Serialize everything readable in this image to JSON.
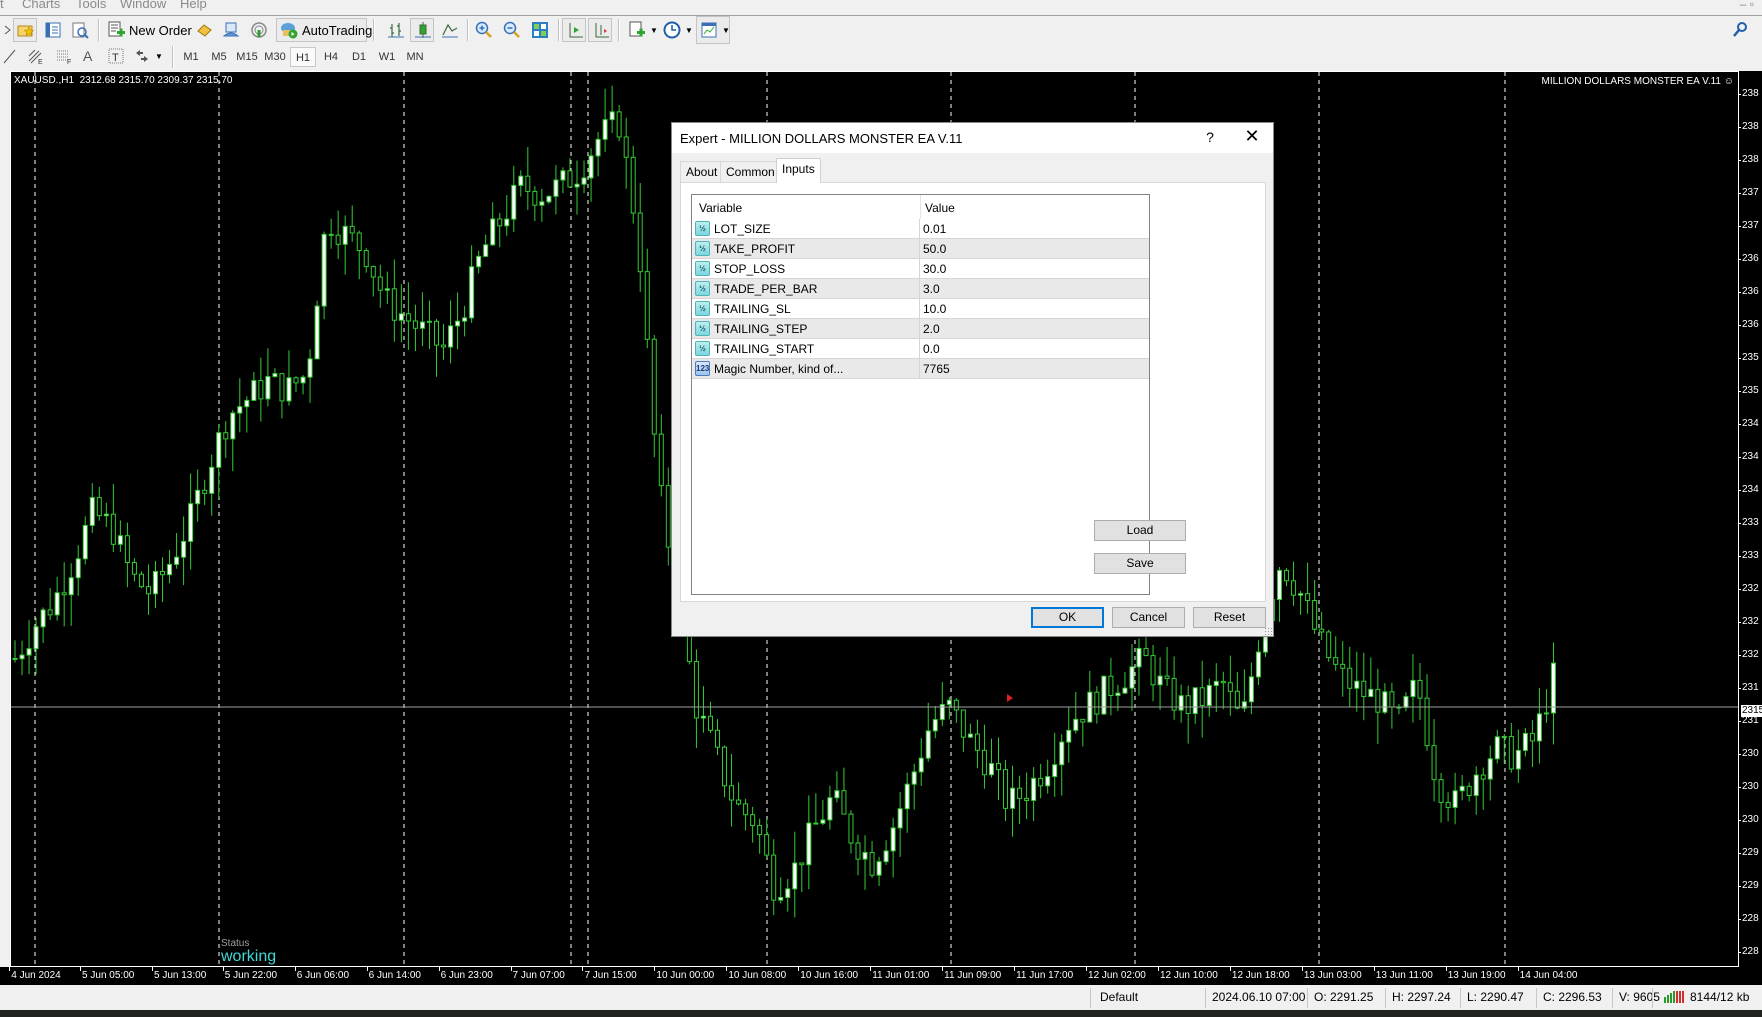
{
  "menu": {
    "items": [
      "Charts",
      "Tools",
      "Window",
      "Help"
    ]
  },
  "toolbar": {
    "new_order": "New Order",
    "autotrading": "AutoTrading",
    "timeframes": [
      "M1",
      "M5",
      "M15",
      "M30",
      "H1",
      "H4",
      "D1",
      "W1",
      "MN"
    ],
    "active_timeframe": "H1"
  },
  "chart": {
    "symbol_line": "XAUUSD.,H1  2312.68 2315.70 2309.37 2315.70",
    "ea_label": "MILLION DOLLARS MONSTER EA V.11",
    "status_label": "Status",
    "status_value": "working",
    "current_price": "2315",
    "price_labels": [
      "238",
      "238",
      "238",
      "237",
      "237",
      "236",
      "236",
      "236",
      "235",
      "235",
      "234",
      "234",
      "234",
      "233",
      "233",
      "232",
      "232",
      "232",
      "231",
      "231",
      "230",
      "230",
      "230",
      "229",
      "229",
      "228",
      "228"
    ],
    "time_labels": [
      "4 Jun 2024",
      "5 Jun 05:00",
      "5 Jun 13:00",
      "5 Jun 22:00",
      "6 Jun 06:00",
      "6 Jun 14:00",
      "6 Jun 23:00",
      "7 Jun 07:00",
      "7 Jun 15:00",
      "10 Jun 00:00",
      "10 Jun 08:00",
      "10 Jun 16:00",
      "11 Jun 01:00",
      "11 Jun 09:00",
      "11 Jun 17:00",
      "12 Jun 02:00",
      "12 Jun 10:00",
      "12 Jun 18:00",
      "13 Jun 03:00",
      "13 Jun 11:00",
      "13 Jun 19:00",
      "14 Jun 04:00"
    ],
    "colors": {
      "background": "#000000",
      "candle": "#33cc33",
      "bull_body": "#ffffff",
      "grid": "#ffffff",
      "bid_line": "#a0a0a0",
      "status_value": "#3fd9d9"
    }
  },
  "chart_data": {
    "type": "candlestick",
    "title": "XAUUSD.,H1",
    "ylim": [
      2280,
      2390
    ],
    "closes": [
      2318,
      2322,
      2325,
      2330,
      2336,
      2334,
      2328,
      2326,
      2330,
      2335,
      2342,
      2348,
      2350,
      2352,
      2351,
      2353,
      2372,
      2370,
      2368,
      2362,
      2360,
      2358,
      2356,
      2361,
      2368,
      2372,
      2376,
      2375,
      2376,
      2378,
      2382,
      2384,
      2370,
      2340,
      2326,
      2312,
      2306,
      2300,
      2298,
      2290,
      2292,
      2297,
      2301,
      2296,
      2293,
      2297,
      2303,
      2310,
      2312,
      2308,
      2305,
      2300,
      2302,
      2305,
      2310,
      2312,
      2314,
      2316,
      2318,
      2314,
      2312,
      2313,
      2315,
      2310,
      2322,
      2330,
      2326,
      2320,
      2316,
      2314,
      2313,
      2310,
      2315,
      2303,
      2300,
      2304,
      2307,
      2306,
      2308,
      2315.7
    ]
  },
  "dialog": {
    "title": "Expert - MILLION DOLLARS MONSTER EA V.11",
    "help": "?",
    "close": "✕",
    "tabs": [
      "About",
      "Common",
      "Inputs"
    ],
    "active_tab": "Inputs",
    "grid": {
      "col_variable": "Variable",
      "col_value": "Value",
      "rows": [
        {
          "icon": "double-type-icon",
          "glyph": "½",
          "name": "LOT_SIZE",
          "value": "0.01"
        },
        {
          "icon": "double-type-icon",
          "glyph": "½",
          "name": "TAKE_PROFIT",
          "value": "50.0"
        },
        {
          "icon": "double-type-icon",
          "glyph": "½",
          "name": "STOP_LOSS",
          "value": "30.0"
        },
        {
          "icon": "double-type-icon",
          "glyph": "½",
          "name": "TRADE_PER_BAR",
          "value": "3.0"
        },
        {
          "icon": "double-type-icon",
          "glyph": "½",
          "name": "TRAILING_SL",
          "value": "10.0"
        },
        {
          "icon": "double-type-icon",
          "glyph": "½",
          "name": "TRAILING_STEP",
          "value": "2.0"
        },
        {
          "icon": "double-type-icon",
          "glyph": "½",
          "name": "TRAILING_START",
          "value": "0.0"
        },
        {
          "icon": "integer-type-icon",
          "glyph": "123",
          "name": "Magic Number, kind of...",
          "value": "7765"
        }
      ]
    },
    "buttons": {
      "load": "Load",
      "save": "Save",
      "ok": "OK",
      "cancel": "Cancel",
      "reset": "Reset"
    }
  },
  "statusbar": {
    "profile": "Default",
    "datetime": "2024.06.10 07:00",
    "open": "O: 2291.25",
    "high": "H: 2297.24",
    "low": "L: 2290.47",
    "close": "C: 2296.53",
    "volume": "V: 9605",
    "traffic": "8144/12 kb"
  }
}
